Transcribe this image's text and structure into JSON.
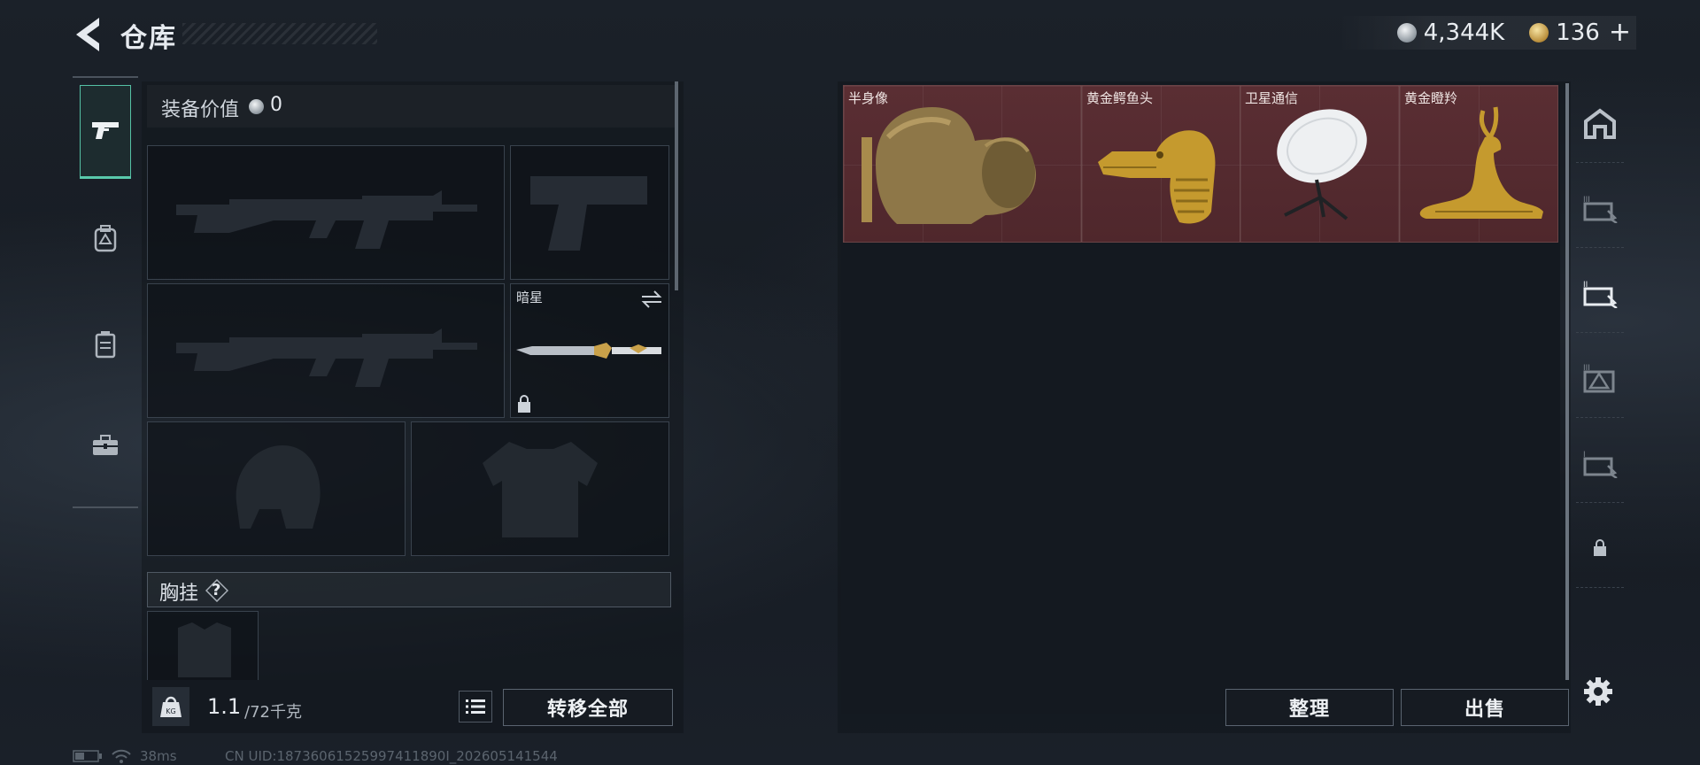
{
  "header": {
    "title": "仓库",
    "currency": [
      {
        "icon": "silver-coin-icon",
        "value": "4,344K"
      },
      {
        "icon": "gold-coin-icon",
        "value": "136"
      }
    ],
    "add_label": "+"
  },
  "left_tabs": [
    {
      "icon": "pistol-icon",
      "active": true
    },
    {
      "icon": "backpack-icon",
      "active": false
    },
    {
      "icon": "case-icon",
      "active": false
    },
    {
      "icon": "toolbox-icon",
      "active": false
    }
  ],
  "loadout": {
    "equip_value_label": "装备价值",
    "equip_value": "0",
    "melee_label": "暗星",
    "vest_label": "胸挂",
    "vest_help": "?"
  },
  "bottom": {
    "weight_current": "1.1",
    "weight_max": "/72千克",
    "transfer_all": "转移全部"
  },
  "storage": {
    "items": [
      {
        "name": "半身像",
        "icon": "bust-statue-icon"
      },
      {
        "name": "黄金鳄鱼头",
        "icon": "golden-crocodile-head-icon"
      },
      {
        "name": "卫星通信",
        "icon": "satellite-dish-icon"
      },
      {
        "name": "黄金瞪羚",
        "icon": "golden-gazelle-icon"
      }
    ],
    "sort_label": "整理",
    "sell_label": "出售"
  },
  "right_tabs": [
    {
      "icon": "safe-house-icon"
    },
    {
      "icon": "storage-3-icon"
    },
    {
      "icon": "storage-2-icon",
      "active": true
    },
    {
      "icon": "storage-warning-icon"
    },
    {
      "icon": "storage-1-icon"
    },
    {
      "icon": "lock-icon"
    }
  ],
  "status": {
    "ping": "38ms",
    "uid": "CN UID:18736061525997411890I_202605141544"
  },
  "colors": {
    "accent": "#59c9ab",
    "item_bg": "#55292e",
    "background": "#181e26"
  }
}
